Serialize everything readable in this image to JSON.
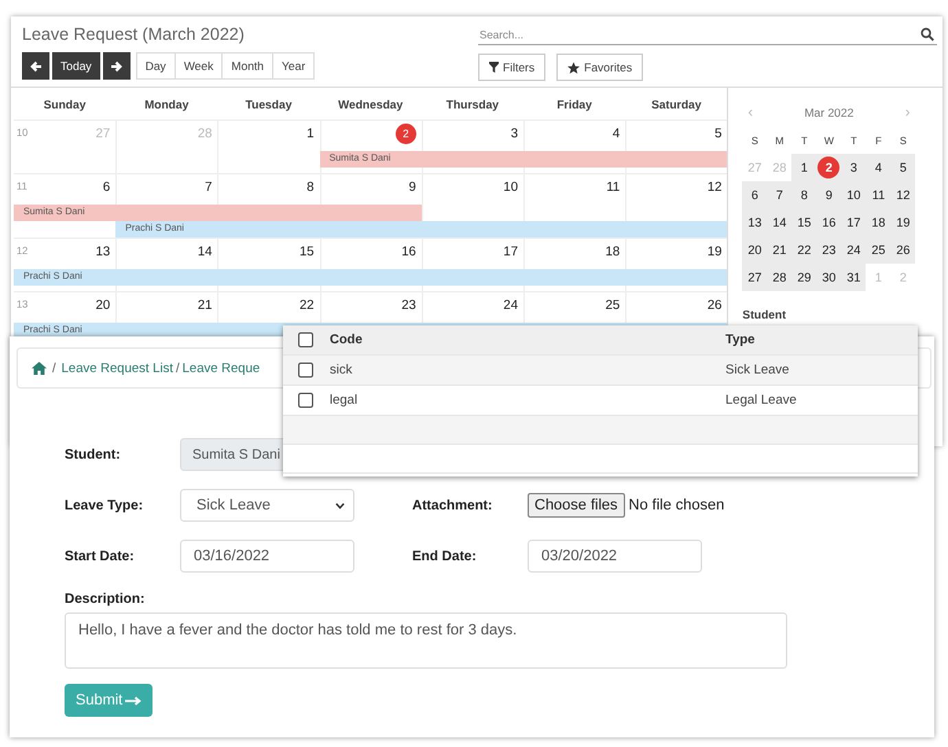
{
  "calendar_window": {
    "title": "Leave Request (March 2022)",
    "nav_buttons": [
      {
        "kind": "prev"
      },
      {
        "kind": "today",
        "label": "Today"
      },
      {
        "kind": "next"
      }
    ],
    "views": [
      {
        "label": "Day",
        "selected": false
      },
      {
        "label": "Week",
        "selected": false
      },
      {
        "label": "Month",
        "selected": false
      },
      {
        "label": "Year",
        "selected": false
      }
    ],
    "search": {
      "placeholder": "Search..."
    },
    "filter_buttons": [
      {
        "kind": "filter",
        "label": "Filters"
      },
      {
        "kind": "favorite",
        "label": "Favorites"
      }
    ],
    "weekdays": [
      "Sunday",
      "Monday",
      "Tuesday",
      "Wednesday",
      "Thursday",
      "Friday",
      "Saturday"
    ],
    "weeks": [
      {
        "number": "10",
        "days": [
          {
            "label": "27",
            "other_month": true,
            "today": false
          },
          {
            "label": "28",
            "other_month": true,
            "today": false
          },
          {
            "label": "1",
            "other_month": false,
            "today": false
          },
          {
            "label": "2",
            "other_month": false,
            "today": true
          },
          {
            "label": "3",
            "other_month": false,
            "today": false
          },
          {
            "label": "4",
            "other_month": false,
            "today": false
          },
          {
            "label": "5",
            "other_month": false,
            "today": false
          }
        ],
        "lanes": [
          {
            "slots": [
              {
                "kind": "empty"
              },
              {
                "kind": "empty"
              },
              {
                "kind": "empty"
              },
              {
                "kind": "event",
                "name": "Sumita S Dani",
                "color": "#f6c4c0"
              },
              {
                "kind": "more"
              },
              {
                "kind": "more"
              },
              {
                "kind": "more"
              }
            ]
          }
        ]
      },
      {
        "number": "11",
        "days": [
          {
            "label": "6",
            "other_month": false,
            "today": false
          },
          {
            "label": "7",
            "other_month": false,
            "today": false
          },
          {
            "label": "8",
            "other_month": false,
            "today": false
          },
          {
            "label": "9",
            "other_month": false,
            "today": false
          },
          {
            "label": "10",
            "other_month": false,
            "today": false
          },
          {
            "label": "11",
            "other_month": false,
            "today": false
          },
          {
            "label": "12",
            "other_month": false,
            "today": false
          }
        ],
        "lanes": [
          {
            "slots": [
              {
                "kind": "event",
                "name": "Sumita S Dani",
                "color": "#f6c4c0"
              },
              {
                "kind": "more"
              },
              {
                "kind": "more"
              },
              {
                "kind": "more"
              },
              {
                "kind": "empty"
              },
              {
                "kind": "empty"
              },
              {
                "kind": "empty"
              }
            ]
          },
          {
            "slots": [
              {
                "kind": "empty"
              },
              {
                "kind": "event",
                "name": "Prachi S Dani",
                "color": "#c8e6f7"
              },
              {
                "kind": "more"
              },
              {
                "kind": "more"
              },
              {
                "kind": "more"
              },
              {
                "kind": "more"
              },
              {
                "kind": "more"
              }
            ]
          }
        ]
      },
      {
        "number": "12",
        "days": [
          {
            "label": "13",
            "other_month": false,
            "today": false
          },
          {
            "label": "14",
            "other_month": false,
            "today": false
          },
          {
            "label": "15",
            "other_month": false,
            "today": false
          },
          {
            "label": "16",
            "other_month": false,
            "today": false
          },
          {
            "label": "17",
            "other_month": false,
            "today": false
          },
          {
            "label": "18",
            "other_month": false,
            "today": false
          },
          {
            "label": "19",
            "other_month": false,
            "today": false
          }
        ],
        "lanes": [
          {
            "slots": [
              {
                "kind": "event",
                "name": "Prachi S Dani",
                "color": "#c8e6f7"
              },
              {
                "kind": "more"
              },
              {
                "kind": "more"
              },
              {
                "kind": "more"
              },
              {
                "kind": "more"
              },
              {
                "kind": "more"
              },
              {
                "kind": "more"
              }
            ]
          }
        ]
      },
      {
        "number": "13",
        "days": [
          {
            "label": "20",
            "other_month": false,
            "today": false
          },
          {
            "label": "21",
            "other_month": false,
            "today": false
          },
          {
            "label": "22",
            "other_month": false,
            "today": false
          },
          {
            "label": "23",
            "other_month": false,
            "today": false
          },
          {
            "label": "24",
            "other_month": false,
            "today": false
          },
          {
            "label": "25",
            "other_month": false,
            "today": false
          },
          {
            "label": "26",
            "other_month": false,
            "today": false
          }
        ],
        "lanes": [
          {
            "slots": [
              {
                "kind": "event",
                "name": "Prachi S Dani",
                "color": "#c8e6f7"
              },
              {
                "kind": "more"
              },
              {
                "kind": "more"
              },
              {
                "kind": "more"
              },
              {
                "kind": "more"
              },
              {
                "kind": "more"
              },
              {
                "kind": "more"
              }
            ]
          }
        ]
      }
    ],
    "mini_calendar": {
      "title": "Mar 2022",
      "prev": "‹",
      "next": "›",
      "weekdays": [
        "S",
        "M",
        "T",
        "W",
        "T",
        "F",
        "S"
      ],
      "weeks": [
        [
          {
            "label": "27",
            "other_month": true,
            "today": false
          },
          {
            "label": "28",
            "other_month": true,
            "today": false
          },
          {
            "label": "1",
            "other_month": false,
            "today": false
          },
          {
            "label": "2",
            "other_month": false,
            "today": true
          },
          {
            "label": "3",
            "other_month": false,
            "today": false
          },
          {
            "label": "4",
            "other_month": false,
            "today": false
          },
          {
            "label": "5",
            "other_month": false,
            "today": false
          }
        ],
        [
          {
            "label": "6",
            "other_month": false,
            "today": false
          },
          {
            "label": "7",
            "other_month": false,
            "today": false
          },
          {
            "label": "8",
            "other_month": false,
            "today": false
          },
          {
            "label": "9",
            "other_month": false,
            "today": false
          },
          {
            "label": "10",
            "other_month": false,
            "today": false
          },
          {
            "label": "11",
            "other_month": false,
            "today": false
          },
          {
            "label": "12",
            "other_month": false,
            "today": false
          }
        ],
        [
          {
            "label": "13",
            "other_month": false,
            "today": false
          },
          {
            "label": "14",
            "other_month": false,
            "today": false
          },
          {
            "label": "15",
            "other_month": false,
            "today": false
          },
          {
            "label": "16",
            "other_month": false,
            "today": false
          },
          {
            "label": "17",
            "other_month": false,
            "today": false
          },
          {
            "label": "18",
            "other_month": false,
            "today": false
          },
          {
            "label": "19",
            "other_month": false,
            "today": false
          }
        ],
        [
          {
            "label": "20",
            "other_month": false,
            "today": false
          },
          {
            "label": "21",
            "other_month": false,
            "today": false
          },
          {
            "label": "22",
            "other_month": false,
            "today": false
          },
          {
            "label": "23",
            "other_month": false,
            "today": false
          },
          {
            "label": "24",
            "other_month": false,
            "today": false
          },
          {
            "label": "25",
            "other_month": false,
            "today": false
          },
          {
            "label": "26",
            "other_month": false,
            "today": false
          }
        ],
        [
          {
            "label": "27",
            "other_month": false,
            "today": false
          },
          {
            "label": "28",
            "other_month": false,
            "today": false
          },
          {
            "label": "29",
            "other_month": false,
            "today": false
          },
          {
            "label": "30",
            "other_month": false,
            "today": false
          },
          {
            "label": "31",
            "other_month": false,
            "today": false
          },
          {
            "label": "1",
            "other_month": true,
            "today": false
          },
          {
            "label": "2",
            "other_month": true,
            "today": false
          }
        ]
      ]
    },
    "sidebar_heading": "Student"
  },
  "form_window": {
    "breadcrumb": [
      {
        "kind": "home"
      },
      {
        "kind": "link",
        "separator": "/",
        "label": "Leave Request List"
      },
      {
        "kind": "link",
        "separator": "/",
        "label": "Leave Reque"
      }
    ],
    "fields": [
      {
        "kind": "readonly",
        "label": "Student:",
        "value": "Sumita S Dani"
      },
      {
        "kind": "select",
        "label": "Leave Type:",
        "value": "Sick Leave"
      },
      {
        "kind": "file",
        "label": "Attachment:",
        "button": "Choose files",
        "status": "No file chosen"
      },
      {
        "kind": "date",
        "label": "Start Date:",
        "value": "03/16/2022"
      },
      {
        "kind": "date",
        "label": "End Date:",
        "value": "03/20/2022"
      },
      {
        "kind": "textarea",
        "label": "Description:",
        "value": "Hello, I have a fever and the doctor has told me to rest for 3 days."
      }
    ],
    "submit": "Submit"
  },
  "lookup_popup": {
    "columns": [
      "Code",
      "Type"
    ],
    "header_checked": false,
    "rows": [
      {
        "code": "sick",
        "type": "Sick Leave",
        "checked": false
      },
      {
        "code": "legal",
        "type": "Legal Leave",
        "checked": false
      }
    ]
  }
}
